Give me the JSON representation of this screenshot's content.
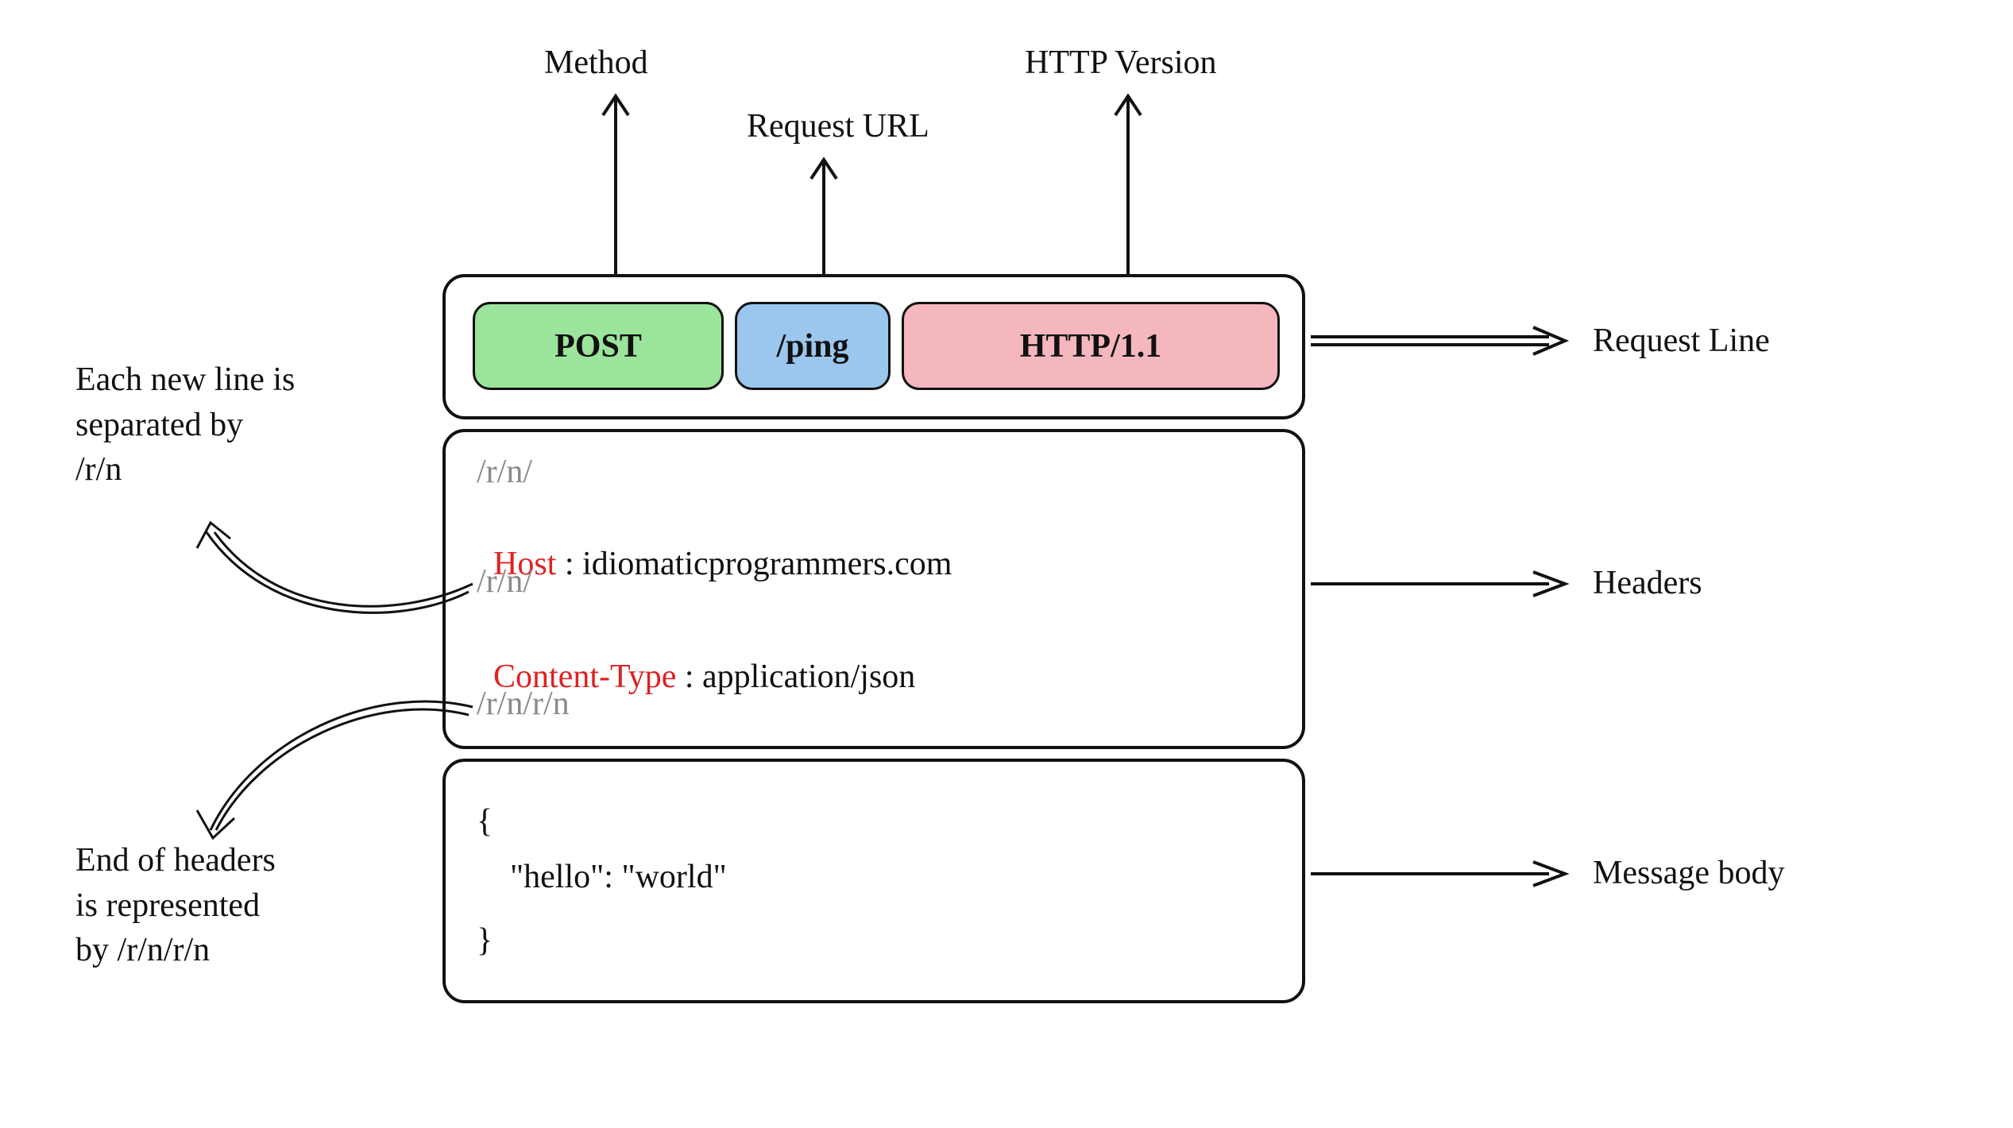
{
  "labels": {
    "method": "Method",
    "requestUrl": "Request URL",
    "httpVersion": "HTTP Version",
    "requestLine": "Request Line",
    "headers": "Headers",
    "messageBody": "Message body"
  },
  "requestLine": {
    "method": "POST",
    "url": "/ping",
    "version": "HTTP/1.1"
  },
  "crlf": {
    "single": "/r/n/",
    "double": "/r/n/r/n"
  },
  "headersBlock": {
    "hostKey": "Host",
    "hostValue": " : idiomaticprogrammers.com",
    "ctypeKey": "Content-Type",
    "ctypeValue": " : application/json"
  },
  "body": {
    "open": "{",
    "line": "    \"hello\": \"world\"",
    "close": "}"
  },
  "notes": {
    "newline": "Each new line is\nseparated by\n/r/n",
    "endHeaders": "End of headers\nis represented\nby /r/n/r/n"
  }
}
